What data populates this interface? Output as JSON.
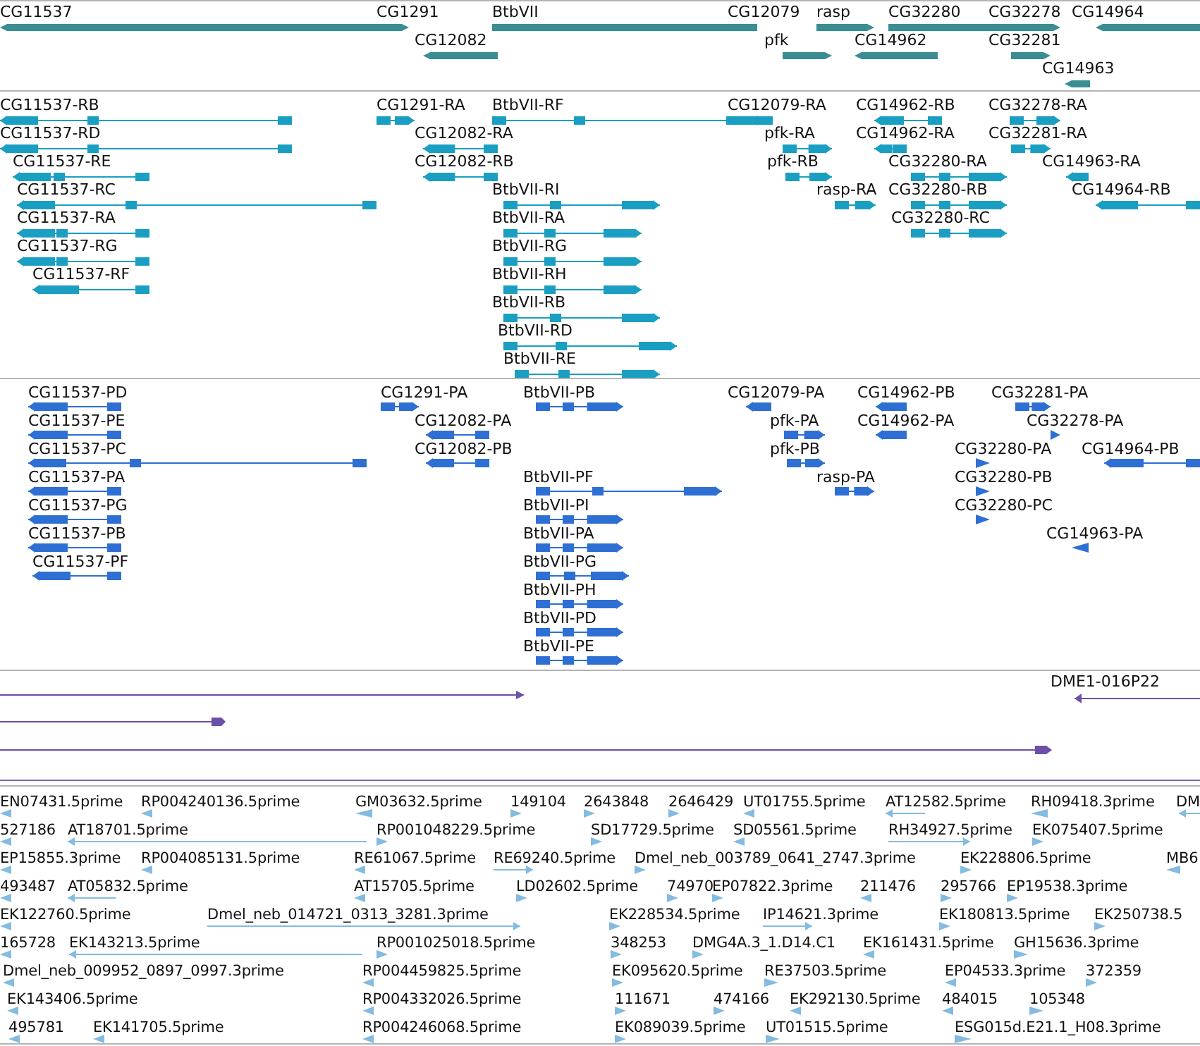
{
  "tracks": [
    {
      "kind": "gene",
      "features": [
        {
          "label": "CG11537"
        },
        {
          "label": "CG1291"
        },
        {
          "label": "BtbVII"
        },
        {
          "label": "CG12079"
        },
        {
          "label": "rasp"
        },
        {
          "label": "CG32280"
        },
        {
          "label": "CG32278"
        },
        {
          "label": "CG14964"
        },
        {
          "label": "CG12082"
        },
        {
          "label": "pfk"
        },
        {
          "label": "CG14962"
        },
        {
          "label": "CG32281"
        },
        {
          "label": "CG14963"
        }
      ]
    },
    {
      "kind": "transcript",
      "features": [
        {
          "label": "CG11537-RB"
        },
        {
          "label": "CG1291-RA"
        },
        {
          "label": "BtbVII-RF"
        },
        {
          "label": "CG12079-RA"
        },
        {
          "label": "CG14962-RB"
        },
        {
          "label": "CG32278-RA"
        },
        {
          "label": "CG11537-RD"
        },
        {
          "label": "CG12082-RA"
        },
        {
          "label": "pfk-RA"
        },
        {
          "label": "CG14962-RA"
        },
        {
          "label": "CG32281-RA"
        },
        {
          "label": "CG11537-RE"
        },
        {
          "label": "CG12082-RB"
        },
        {
          "label": "pfk-RB"
        },
        {
          "label": "CG32280-RA"
        },
        {
          "label": "CG14963-RA"
        },
        {
          "label": "CG11537-RC"
        },
        {
          "label": "BtbVII-RI"
        },
        {
          "label": "rasp-RA"
        },
        {
          "label": "CG32280-RB"
        },
        {
          "label": "CG14964-RB"
        },
        {
          "label": "CG11537-RA"
        },
        {
          "label": "BtbVII-RA"
        },
        {
          "label": "CG32280-RC"
        },
        {
          "label": "CG11537-RG"
        },
        {
          "label": "BtbVII-RG"
        },
        {
          "label": "CG11537-RF"
        },
        {
          "label": "BtbVII-RH"
        },
        {
          "label": "BtbVII-RB"
        },
        {
          "label": "BtbVII-RD"
        },
        {
          "label": "BtbVII-RE"
        }
      ]
    },
    {
      "kind": "protein",
      "features": [
        {
          "label": "CG11537-PD"
        },
        {
          "label": "CG1291-PA"
        },
        {
          "label": "BtbVII-PB"
        },
        {
          "label": "CG12079-PA"
        },
        {
          "label": "CG14962-PB"
        },
        {
          "label": "CG32281-PA"
        },
        {
          "label": "CG11537-PE"
        },
        {
          "label": "CG12082-PA"
        },
        {
          "label": "pfk-PA"
        },
        {
          "label": "CG14962-PA"
        },
        {
          "label": "CG32278-PA"
        },
        {
          "label": "CG11537-PC"
        },
        {
          "label": "CG12082-PB"
        },
        {
          "label": "pfk-PB"
        },
        {
          "label": "CG32280-PA"
        },
        {
          "label": "CG14964-PB"
        },
        {
          "label": "CG11537-PA"
        },
        {
          "label": "BtbVII-PF"
        },
        {
          "label": "rasp-PA"
        },
        {
          "label": "CG32280-PB"
        },
        {
          "label": "CG11537-PG"
        },
        {
          "label": "BtbVII-PI"
        },
        {
          "label": "CG32280-PC"
        },
        {
          "label": "CG11537-PB"
        },
        {
          "label": "BtbVII-PA"
        },
        {
          "label": "CG14963-PA"
        },
        {
          "label": "CG11537-PF"
        },
        {
          "label": "BtbVII-PG"
        },
        {
          "label": "BtbVII-PH"
        },
        {
          "label": "BtbVII-PD"
        },
        {
          "label": "BtbVII-PE"
        }
      ]
    },
    {
      "kind": "clone",
      "features": [
        {
          "label": "DME1-016P22"
        }
      ]
    },
    {
      "kind": "est",
      "features": [
        {
          "label": "EN07431.5prime"
        },
        {
          "label": "RP004240136.5prime"
        },
        {
          "label": "GM03632.5prime"
        },
        {
          "label": "149104"
        },
        {
          "label": "2643848"
        },
        {
          "label": "2646429"
        },
        {
          "label": "UT01755.5prime"
        },
        {
          "label": "AT12582.5prime"
        },
        {
          "label": "RH09418.3prime"
        },
        {
          "label": "DM"
        },
        {
          "label": "527186"
        },
        {
          "label": "AT18701.5prime"
        },
        {
          "label": "RP001048229.5prime"
        },
        {
          "label": "SD17729.5prime"
        },
        {
          "label": "SD05561.5prime"
        },
        {
          "label": "RH34927.5prime"
        },
        {
          "label": "EK075407.5prime"
        },
        {
          "label": "EP15855.3prime"
        },
        {
          "label": "RP004085131.5prime"
        },
        {
          "label": "RE61067.5prime"
        },
        {
          "label": "RE69240.5prime"
        },
        {
          "label": "Dmel_neb_003789_0641_2747.3prime"
        },
        {
          "label": "EK228806.5prime"
        },
        {
          "label": "MB6"
        },
        {
          "label": "493487"
        },
        {
          "label": "AT05832.5prime"
        },
        {
          "label": "AT15705.5prime"
        },
        {
          "label": "LD02602.5prime"
        },
        {
          "label": "74970"
        },
        {
          "label": "EP07822.3prime"
        },
        {
          "label": "211476"
        },
        {
          "label": "295766"
        },
        {
          "label": "EP19538.3prime"
        },
        {
          "label": "EK122760.5prime"
        },
        {
          "label": "Dmel_neb_014721_0313_3281.3prime"
        },
        {
          "label": "EK228534.5prime"
        },
        {
          "label": "IP14621.3prime"
        },
        {
          "label": "EK180813.5prime"
        },
        {
          "label": "EK250738.5"
        },
        {
          "label": "165728"
        },
        {
          "label": "EK143213.5prime"
        },
        {
          "label": "RP001025018.5prime"
        },
        {
          "label": "348253"
        },
        {
          "label": "DMG4A.3_1.D14.C1"
        },
        {
          "label": "EK161431.5prime"
        },
        {
          "label": "GH15636.3prime"
        },
        {
          "label": "Dmel_neb_009952_0897_0997.3prime"
        },
        {
          "label": "RP004459825.5prime"
        },
        {
          "label": "EK095620.5prime"
        },
        {
          "label": "RE37503.5prime"
        },
        {
          "label": "EP04533.3prime"
        },
        {
          "label": "372359"
        },
        {
          "label": "EK143406.5prime"
        },
        {
          "label": "RP004332026.5prime"
        },
        {
          "label": "111671"
        },
        {
          "label": "474166"
        },
        {
          "label": "EK292130.5prime"
        },
        {
          "label": "484015"
        },
        {
          "label": "105348"
        },
        {
          "label": "495781"
        },
        {
          "label": "EK141705.5prime"
        },
        {
          "label": "RP004246068.5prime"
        },
        {
          "label": "EK089039.5prime"
        },
        {
          "label": "UT01515.5prime"
        },
        {
          "label": "ESG015d.E21.1_H08.3prime"
        }
      ]
    }
  ]
}
